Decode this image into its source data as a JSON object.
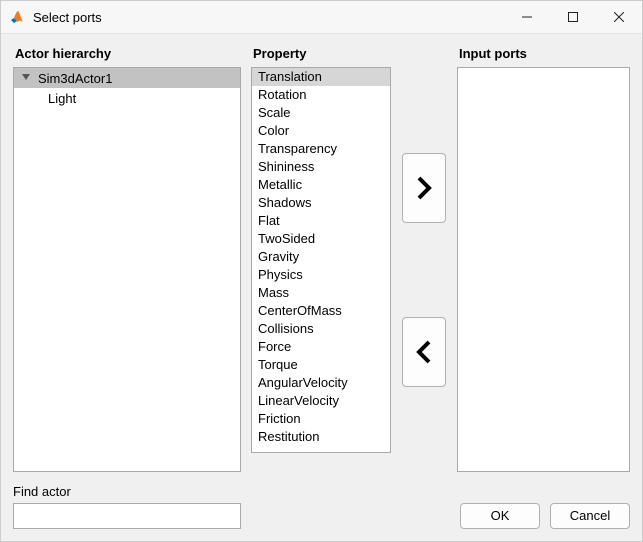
{
  "window": {
    "title": "Select ports"
  },
  "headings": {
    "actor_hierarchy": "Actor hierarchy",
    "property": "Property",
    "input_ports": "Input ports"
  },
  "tree": {
    "root": "Sim3dActor1",
    "children": [
      "Light"
    ]
  },
  "properties": [
    "Translation",
    "Rotation",
    "Scale",
    "Color",
    "Transparency",
    "Shininess",
    "Metallic",
    "Shadows",
    "Flat",
    "TwoSided",
    "Gravity",
    "Physics",
    "Mass",
    "CenterOfMass",
    "Collisions",
    "Force",
    "Torque",
    "AngularVelocity",
    "LinearVelocity",
    "Friction",
    "Restitution"
  ],
  "selected_property_index": 0,
  "input_ports": [],
  "find": {
    "label": "Find actor",
    "value": ""
  },
  "buttons": {
    "ok": "OK",
    "cancel": "Cancel"
  }
}
